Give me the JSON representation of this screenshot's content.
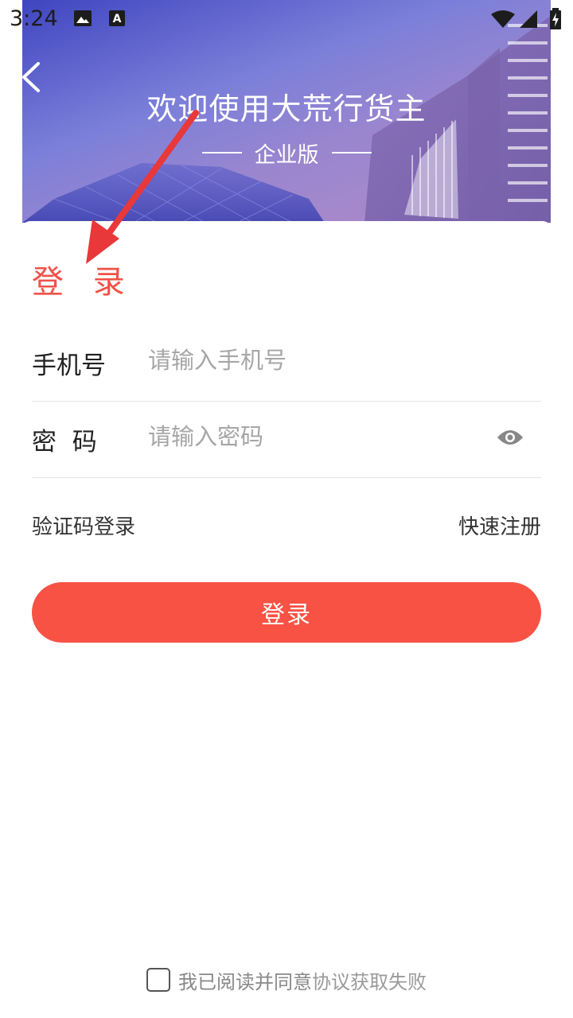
{
  "status_bar": {
    "time": "3:24",
    "icons": [
      "image-icon",
      "accessibility-a-icon",
      "wifi-icon",
      "signal-icon",
      "battery-charging-icon"
    ]
  },
  "header": {
    "back_icon": "chevron-left-icon",
    "title": "欢迎使用大荒行货主",
    "subtitle": "企业版"
  },
  "form": {
    "heading": "登 录",
    "phone": {
      "label": "手机号",
      "placeholder": "请输入手机号",
      "value": ""
    },
    "password": {
      "label": "密  码",
      "placeholder": "请输入密码",
      "value": "",
      "toggle_icon": "eye-icon"
    },
    "sms_login_link": "验证码登录",
    "register_link": "快速注册",
    "submit_label": "登录"
  },
  "agreement": {
    "checked": false,
    "text": "我已阅读并同意",
    "link_text": "协议获取失败"
  },
  "colors": {
    "accent": "#f75244",
    "heading_red": "#f05248",
    "hero_blue": "#4a4fc8",
    "annotation_arrow": "#e8383a"
  }
}
